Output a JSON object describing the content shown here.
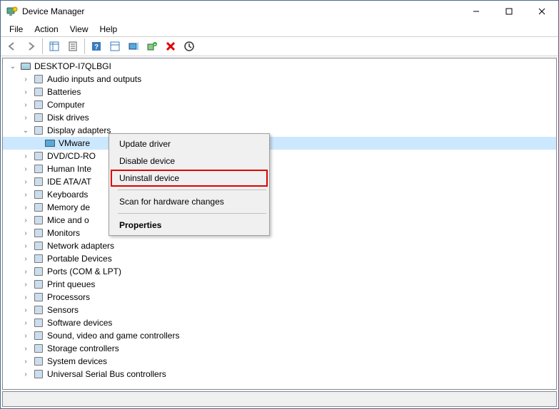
{
  "window": {
    "title": "Device Manager"
  },
  "menu": {
    "file": "File",
    "action": "Action",
    "view": "View",
    "help": "Help"
  },
  "tree": {
    "root": "DESKTOP-I7QLBGI",
    "items": [
      {
        "label": "Audio inputs and outputs",
        "expanded": false
      },
      {
        "label": "Batteries",
        "expanded": false
      },
      {
        "label": "Computer",
        "expanded": false
      },
      {
        "label": "Disk drives",
        "expanded": false
      },
      {
        "label": "Display adapters",
        "expanded": true,
        "children": [
          {
            "label": "VMware",
            "selected": true
          }
        ]
      },
      {
        "label": "DVD/CD-RO",
        "expanded": false
      },
      {
        "label": "Human Inte",
        "expanded": false
      },
      {
        "label": "IDE ATA/AT",
        "expanded": false
      },
      {
        "label": "Keyboards",
        "expanded": false
      },
      {
        "label": "Memory de",
        "expanded": false
      },
      {
        "label": "Mice and o",
        "expanded": false
      },
      {
        "label": "Monitors",
        "expanded": false
      },
      {
        "label": "Network adapters",
        "expanded": false
      },
      {
        "label": "Portable Devices",
        "expanded": false
      },
      {
        "label": "Ports (COM & LPT)",
        "expanded": false
      },
      {
        "label": "Print queues",
        "expanded": false
      },
      {
        "label": "Processors",
        "expanded": false
      },
      {
        "label": "Sensors",
        "expanded": false
      },
      {
        "label": "Software devices",
        "expanded": false
      },
      {
        "label": "Sound, video and game controllers",
        "expanded": false
      },
      {
        "label": "Storage controllers",
        "expanded": false
      },
      {
        "label": "System devices",
        "expanded": false
      },
      {
        "label": "Universal Serial Bus controllers",
        "expanded": false
      }
    ]
  },
  "context_menu": {
    "update": "Update driver",
    "disable": "Disable device",
    "uninstall": "Uninstall device",
    "scan": "Scan for hardware changes",
    "properties": "Properties"
  }
}
